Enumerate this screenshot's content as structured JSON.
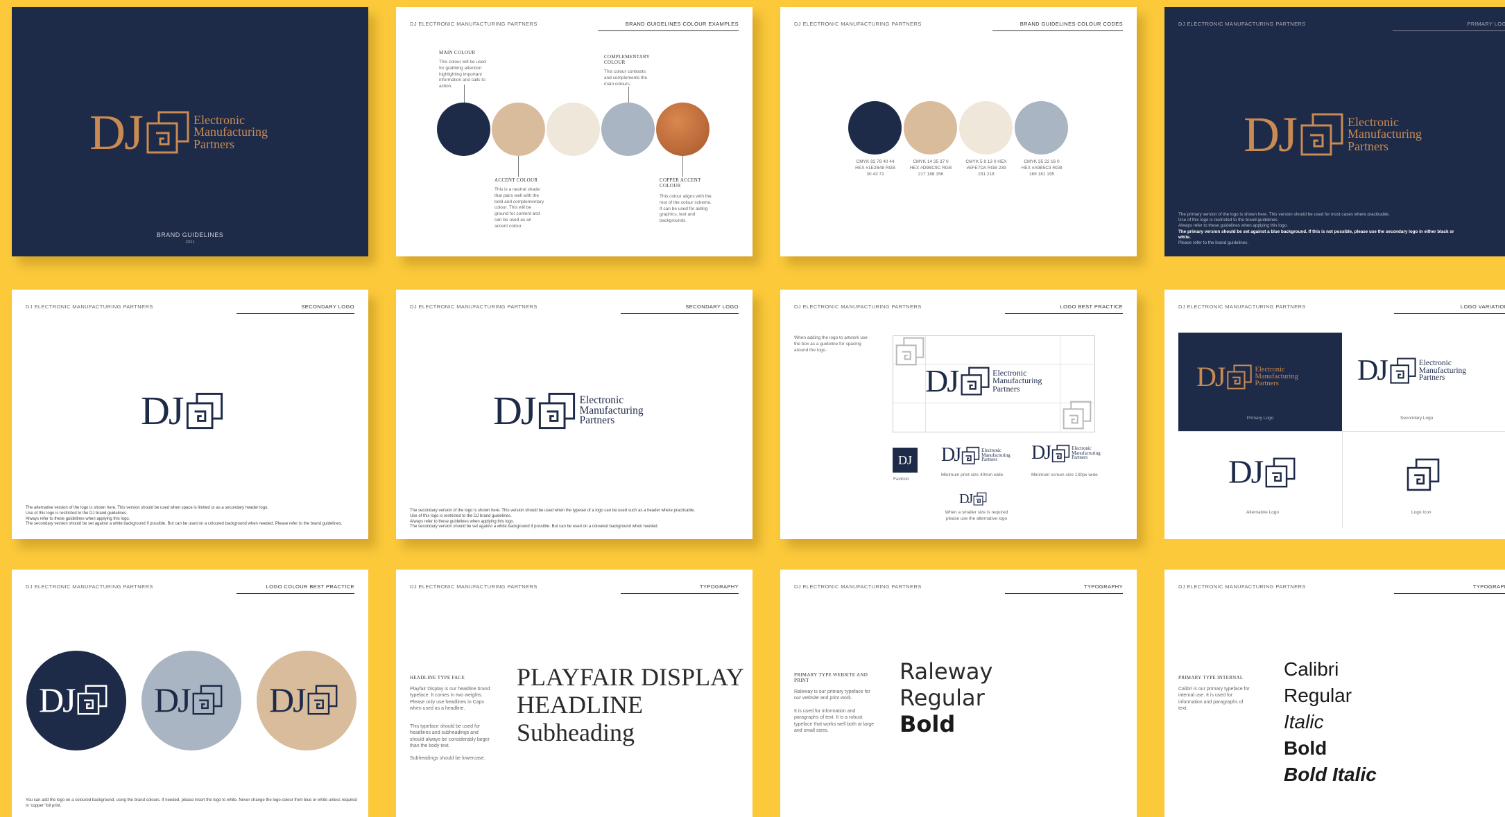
{
  "brand": "DJ ELECTRONIC MANUFACTURING PARTNERS",
  "logo": {
    "initials": "DJ",
    "line1": "Electronic",
    "line2": "Manufacturing",
    "line3": "Partners"
  },
  "colors": {
    "background": "#FBC93A",
    "navy": "#1E2B48",
    "beige": "#D9BC9C",
    "cream": "#EFE7DA",
    "grey_blue": "#A9B5C3",
    "copper": "#B86B3A"
  },
  "slides": {
    "cover": {
      "caption": "BRAND GUIDELINES",
      "year": "2021"
    },
    "colour_examples": {
      "title": "BRAND GUIDELINES COLOUR EXAMPLES",
      "main_title": "MAIN COLOUR",
      "main_text": "This colour will be used for grabbing attention highlighting important information and calls to action.",
      "comp_title": "COMPLEMENTARY COLOUR",
      "comp_text": "This colour contrasts and complements the main colours.",
      "accent_title": "ACCENT COLOUR",
      "accent_text": "This is a neutral shade that pairs well with the bold and complementary colour. This will be ground for content and can be used as an accent colour.",
      "copper_title": "COPPER ACCENT COLOUR",
      "copper_text": "This colour aligns with the rest of the colour scheme. It can be used for aiding graphics, text and backgrounds."
    },
    "colour_codes": {
      "title": "BRAND GUIDELINES COLOUR CODES",
      "codes": [
        "CMYK 92 78 40 44 HEX #1E2B48 RGB 30 43 72",
        "CMYK 14 25 37 0 HEX #D9BC9C RGB 217 188 156",
        "CMYK 5 8 13 0 HEX #EFE7DA RGB 239 231 218",
        "CMYK 35 22 16 0 HEX #A9B5C3 RGB 169 181 195"
      ]
    },
    "primary_logo": {
      "title": "PRIMARY LOGO",
      "line1": "The primary version of the logo is shown here. This version should be used for most cases where practicable.",
      "line2": "Use of this logo is restricted to the brand guidelines.",
      "line3": "Always refer to these guidelines when applying this logo.",
      "line4": "The primary version should be set against a blue background. If this is not possible, please use the secondary logo in either black or white.",
      "line5": "Please refer to the brand guidelines."
    },
    "secondary_logo_1": {
      "title": "SECONDARY LOGO",
      "line1": "The alternative version of the logo is shown here. This version should be used when space is limited or as a secondary header logo.",
      "line2": "Use of this logo is restricted to the DJ brand guidelines.",
      "line3": "Always refer to these guidelines when applying this logo.",
      "line4": "The secondary version should be set against a white background if possible. But can be used on a coloured background when needed. Please refer to the brand guidelines."
    },
    "secondary_logo_2": {
      "title": "SECONDARY LOGO",
      "line1": "The secondary version of the logo is shown here. This version should be used when the typeset of a logo can be used such as a header where practicable.",
      "line2": "Use of this logo is restricted to the DJ brand guidelines.",
      "line3": "Always refer to these guidelines when applying this logo.",
      "line4": "The secondary version should be set against a white background if possible. But can be used on a coloured background when needed."
    },
    "best_practice": {
      "title": "LOGO BEST PRACTICE",
      "intro": "When adding the logo to artwork use the box as a guideline for spacing around the logo.",
      "favicon": "Favicon",
      "min_print": "Minimum print size 40mm wide",
      "min_screen": "Minimum screen size 130px wide",
      "smaller1": "When a smaller size is required",
      "smaller2": "please use the alternative logo"
    },
    "variations": {
      "title": "LOGO VARIATIONS",
      "primary": "Primary Logo",
      "secondary": "Secondary Logo",
      "alternative": "Alternative Logo",
      "logo_icon": "Logo Icon"
    },
    "colour_best_practice": {
      "title": "LOGO COLOUR BEST PRACTICE",
      "text": "You can add the logo on a coloured background, using the brand colours. If needed, please insert the logo to white. Never change the logo colour from blue or white unless required in 'copper' foil print."
    },
    "typography_1": {
      "title": "TYPOGRAPHY",
      "label": "HEADLINE TYPE FACE",
      "p1": "Playfair Display is our headline brand typeface. It comes in two weights. Please only use headlines in Caps when used as a headline.",
      "p2": "This typeface should be used for headlines and subheadings and should always be considerably larger than the body text.",
      "p3": "Subheadings should be lowercase.",
      "big1": "PLAYFAIR DISPLAY",
      "big2": "HEADLINE",
      "big3": "Subheading"
    },
    "typography_2": {
      "title": "TYPOGRAPHY",
      "label": "PRIMARY TYPE WEBSITE AND PRINT",
      "p1": "Raleway is our primary typeface for our website and print work.",
      "p2": "It is used for information and paragraphs of text. It is a robust typeface that works well both at large and small sizes.",
      "big1": "Raleway",
      "big2": "Regular",
      "big3": "Bold"
    },
    "typography_3": {
      "title": "TYPOGRAPHY",
      "label": "PRIMARY TYPE INTERNAL",
      "p1": "Calibri is our primary typeface for internal use. It is used for information and paragraphs of text.",
      "big1": "Calibri",
      "big2": "Regular",
      "big3": "Italic",
      "big4": "Bold",
      "big5": "Bold Italic"
    }
  }
}
